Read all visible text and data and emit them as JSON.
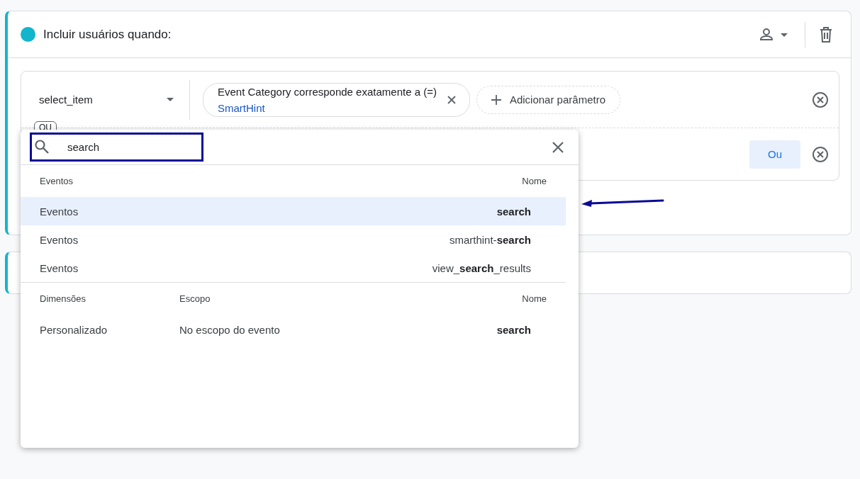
{
  "condition_card": {
    "title": "Incluir usuários quando:",
    "event_select": {
      "value": "select_item"
    },
    "parameter_chip": {
      "label": "Event Category corresponde exatamente a (=)",
      "value": "SmartHint"
    },
    "add_parameter": "Adicionar parâmetro",
    "or_chip": "OU",
    "or_button": "Ou"
  },
  "dropdown": {
    "search": {
      "value": "search"
    },
    "event_section": {
      "columns": [
        "Eventos",
        "Nome"
      ],
      "rows": [
        {
          "category": "Eventos",
          "name": "**search**",
          "selected": true
        },
        {
          "category": "Eventos",
          "name": "smarthint-**search**",
          "selected": false
        },
        {
          "category": "Eventos",
          "name": "view_**search**_results",
          "selected": false
        }
      ]
    },
    "dimension_section": {
      "columns": [
        "Dimensões",
        "Escopo",
        "Nome"
      ],
      "rows": [
        {
          "category": "Personalizado",
          "scope": "No escopo do evento",
          "name": "**search**",
          "selected": false
        }
      ]
    }
  }
}
